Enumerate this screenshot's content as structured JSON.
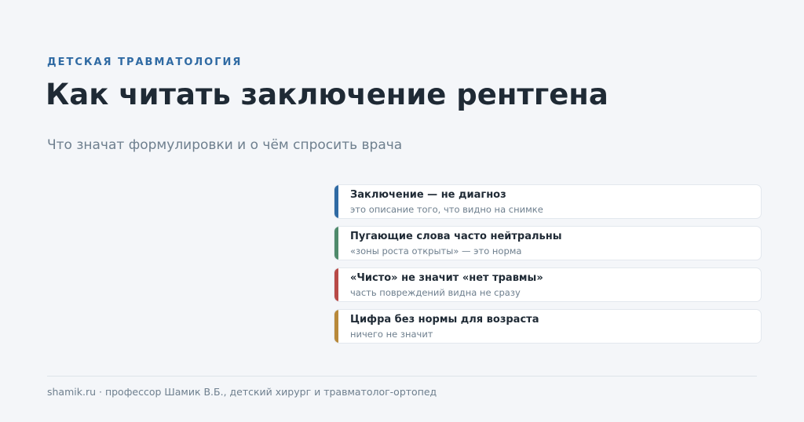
{
  "header": {
    "eyebrow": "ДЕТСКАЯ ТРАВМАТОЛОГИЯ",
    "title": "Как читать заключение рентгена",
    "subtitle": "Что значат формулировки и о чём спросить врача"
  },
  "cards": [
    {
      "title": "Заключение — не диагноз",
      "subtitle": "это описание того, что видно на снимке",
      "accent": "#2f6aa3"
    },
    {
      "title": "Пугающие слова часто нейтральны",
      "subtitle": "«зоны роста открыты» — это норма",
      "accent": "#4f8a6b"
    },
    {
      "title": "«Чисто» не значит «нет травмы»",
      "subtitle": "часть повреждений видна не сразу",
      "accent": "#b84a47"
    },
    {
      "title": "Цифра без нормы для возраста",
      "subtitle": "ничего не значит",
      "accent": "#b8893a"
    }
  ],
  "footer": {
    "text": "shamik.ru · профессор Шамик В.Б., детский хирург и травматолог-ортопед"
  }
}
